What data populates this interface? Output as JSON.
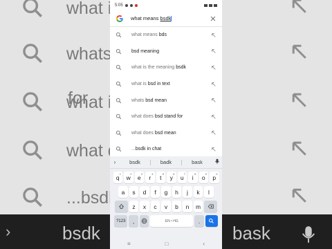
{
  "status_bar": {
    "time": "5:05"
  },
  "search": {
    "query_prefix": "what means ",
    "query_underlined": "bsdk"
  },
  "suggestions": [
    {
      "prefix": "what means ",
      "match": "bds"
    },
    {
      "prefix": "",
      "match": "bsd meaning"
    },
    {
      "prefix": "what is the meaning ",
      "match": "bsdk"
    },
    {
      "prefix": "what is ",
      "match": "bsd in text"
    },
    {
      "prefix": "whats ",
      "match": "bsd mean"
    },
    {
      "prefix": "what does ",
      "match": "bsd stand for"
    },
    {
      "prefix": "what does ",
      "match": "bsd mean"
    },
    {
      "prefix": "...",
      "match": "bsdk in chat"
    }
  ],
  "keyboard": {
    "suggestions": [
      "bsdk",
      "badk",
      "bask"
    ],
    "row1": [
      {
        "k": "q",
        "n": "1"
      },
      {
        "k": "w",
        "n": "2"
      },
      {
        "k": "e",
        "n": "3"
      },
      {
        "k": "r",
        "n": "4"
      },
      {
        "k": "t",
        "n": "5"
      },
      {
        "k": "y",
        "n": "6"
      },
      {
        "k": "u",
        "n": "7"
      },
      {
        "k": "i",
        "n": "8"
      },
      {
        "k": "o",
        "n": "9"
      },
      {
        "k": "p",
        "n": "0"
      }
    ],
    "row2": [
      "a",
      "s",
      "d",
      "f",
      "g",
      "h",
      "j",
      "k",
      "l"
    ],
    "row3": [
      "z",
      "x",
      "c",
      "v",
      "b",
      "n",
      "m"
    ],
    "numbers_label": "?123",
    "comma_label": ",",
    "space_label": "EN • HG",
    "period_label": "."
  },
  "background": {
    "rows": [
      "what is",
      "whats",
      "what is",
      "what is",
      "what d",
      "what d",
      "what d",
      "...bsdk"
    ],
    "rows_right": [
      "",
      "",
      "",
      "",
      "",
      "for",
      "",
      ""
    ],
    "keyboard_words": [
      "bsdk",
      "badk",
      "bask"
    ]
  },
  "accent_color": "#1a73e8"
}
